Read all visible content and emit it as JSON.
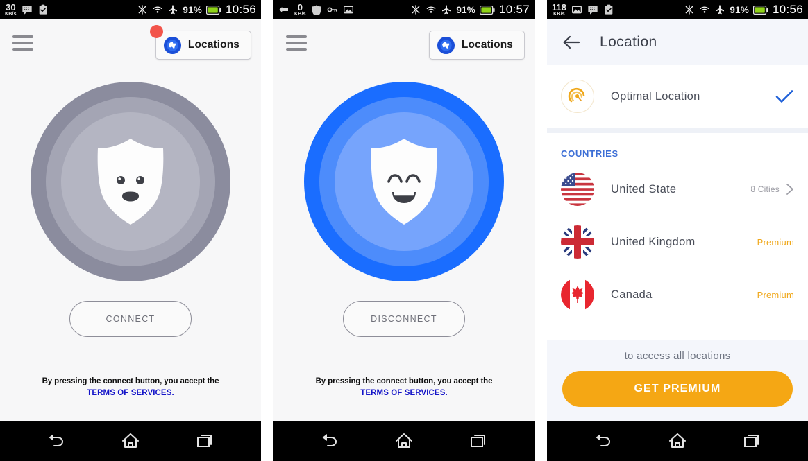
{
  "colors": {
    "accent_blue": "#1a6dff",
    "ring_blue_outer": "#1a6dff",
    "ring_blue_mid": "#4d8cfb",
    "ring_blue_inner": "#76a4fc",
    "ring_gray_outer": "#8b8c9e",
    "ring_gray_mid": "#a4a5b4",
    "ring_gray_inner": "#b4b5c2",
    "premium_orange": "#f5a714",
    "terms_link": "#1414c8",
    "badge_red": "#f2544a",
    "countries_header": "#3d6fd6"
  },
  "panel1": {
    "statusbar": {
      "net_speed": "30",
      "net_unit": "KB/s",
      "left_icons": [
        "messaging-icon",
        "clipboard-check-icon"
      ],
      "right_icons": [
        "mute-icon",
        "wifi-icon",
        "airplane-mode-icon"
      ],
      "battery_pct": "91%",
      "battery_icon": "battery-icon",
      "clock": "10:56"
    },
    "menu_icon": "hamburger-menu-icon",
    "locations_button": {
      "label": "Locations",
      "icon": "globe-icon",
      "badge": true
    },
    "shield": {
      "icon": "shield-face-neutral-icon",
      "state": "disconnected"
    },
    "cta_label": "CONNECT",
    "terms": {
      "line1": "By pressing the connect button, you accept the",
      "line2": "TERMS OF SERVICES."
    },
    "navbar": [
      "back-icon",
      "home-icon",
      "recents-icon"
    ]
  },
  "panel2": {
    "statusbar": {
      "net_speed": "0",
      "net_unit": "KB/s",
      "left_icons": [
        "vpn-key-arrow-icon",
        "shield-icon",
        "key-icon",
        "image-icon"
      ],
      "right_icons": [
        "mute-icon",
        "wifi-icon",
        "airplane-mode-icon"
      ],
      "battery_pct": "91%",
      "battery_icon": "battery-icon",
      "clock": "10:57"
    },
    "menu_icon": "hamburger-menu-icon",
    "locations_button": {
      "label": "Locations",
      "icon": "globe-icon",
      "badge": false
    },
    "shield": {
      "icon": "shield-face-happy-icon",
      "state": "connected"
    },
    "cta_label": "DISCONNECT",
    "terms": {
      "line1": "By pressing the connect button, you accept the",
      "line2": "TERMS OF SERVICES."
    },
    "navbar": [
      "back-icon",
      "home-icon",
      "recents-icon"
    ]
  },
  "panel3": {
    "statusbar": {
      "net_speed": "118",
      "net_unit": "KB/s",
      "left_icons": [
        "image-icon",
        "messaging-icon",
        "clipboard-check-icon"
      ],
      "right_icons": [
        "mute-icon",
        "wifi-icon",
        "airplane-mode-icon"
      ],
      "battery_pct": "91%",
      "battery_icon": "battery-icon",
      "clock": "10:56"
    },
    "back_icon": "back-arrow-icon",
    "title": "Location",
    "optimal": {
      "label": "Optimal Location",
      "icon": "speedometer-icon",
      "selected_icon": "check-icon",
      "selected": true
    },
    "countries_header": "COUNTRIES",
    "countries": [
      {
        "name": "United State",
        "flag": "flag-us",
        "meta": "8 Cities",
        "premium": false,
        "chevron": true
      },
      {
        "name": "United Kingdom",
        "flag": "flag-uk",
        "meta": "Premium",
        "premium": true,
        "chevron": false
      },
      {
        "name": "Canada",
        "flag": "flag-ca",
        "meta": "Premium",
        "premium": true,
        "chevron": false
      }
    ],
    "premium_sub": "to access all locations",
    "premium_button": "GET PREMIUM",
    "navbar": [
      "back-icon",
      "home-icon",
      "recents-icon"
    ]
  }
}
